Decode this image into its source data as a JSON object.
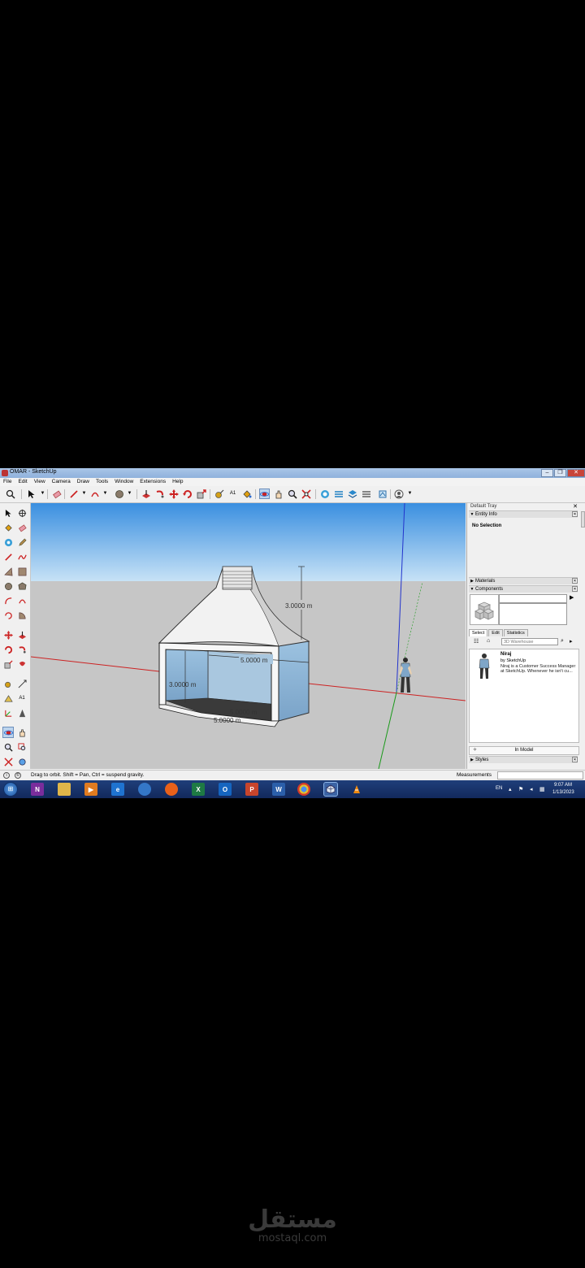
{
  "window": {
    "title": "OMAR - SketchUp",
    "buttons": [
      "–",
      "❐",
      "✕"
    ]
  },
  "menu": [
    "File",
    "Edit",
    "View",
    "Camera",
    "Draw",
    "Tools",
    "Window",
    "Extensions",
    "Help"
  ],
  "toolbar": {
    "icons": [
      "search-icon",
      "select-icon",
      "eraser-icon",
      "line-icon",
      "arc-icon",
      "shape-icon",
      "pushpull-icon",
      "followme-icon",
      "move-icon",
      "rotate-icon",
      "scale-icon",
      "tape-icon",
      "text-icon",
      "paint-icon",
      "orbit-icon",
      "pan-icon",
      "zoom-icon",
      "zoom-extents-icon",
      "warehouse-icon",
      "extension-warehouse-icon",
      "layout-icon",
      "style-builder-icon",
      "account-icon"
    ]
  },
  "viewport": {
    "dimensions": {
      "height_top": "3.0000 m",
      "width_front": "5.0000 m",
      "height_side": "3.0000 m",
      "depth_floor": "5.0000 m",
      "width_floor": "5.0000 m"
    },
    "colors": {
      "sky_top": "#3a8fe0",
      "sky_bottom": "#c7e2f6",
      "ground": "#c6c6c6",
      "red_axis": "#cc2222",
      "green_axis": "#1a9a1a",
      "blue_axis": "#2233cc"
    }
  },
  "tray": {
    "title": "Default Tray",
    "entity_info": {
      "label": "Entity Info",
      "selection": "No Selection"
    },
    "materials": {
      "label": "Materials"
    },
    "components": {
      "label": "Components",
      "tabs": [
        "Select",
        "Edit",
        "Statistics"
      ],
      "search_placeholder": "3D Warehouse",
      "result": {
        "title": "Niraj",
        "by": "by SketchUp",
        "desc1": "Niraj is a Customer Success Manager",
        "desc2": "at SketchUp. Whenever he isn't cu..."
      },
      "footer": "In Model"
    },
    "styles": {
      "label": "Styles"
    }
  },
  "status": {
    "hint": "Drag to orbit. Shift = Pan, Ctrl = suspend gravity.",
    "measurements_label": "Measurements",
    "measurements_value": ""
  },
  "taskbar": {
    "apps": [
      "N",
      "",
      "",
      "",
      "e",
      "",
      "",
      "X",
      "O",
      "P",
      "W",
      "",
      "",
      "",
      ""
    ],
    "language": "EN",
    "time": "9:07 AM",
    "date": "1/13/2023"
  },
  "watermark": {
    "arabic": "مستقل",
    "url": "mostaql.com"
  }
}
